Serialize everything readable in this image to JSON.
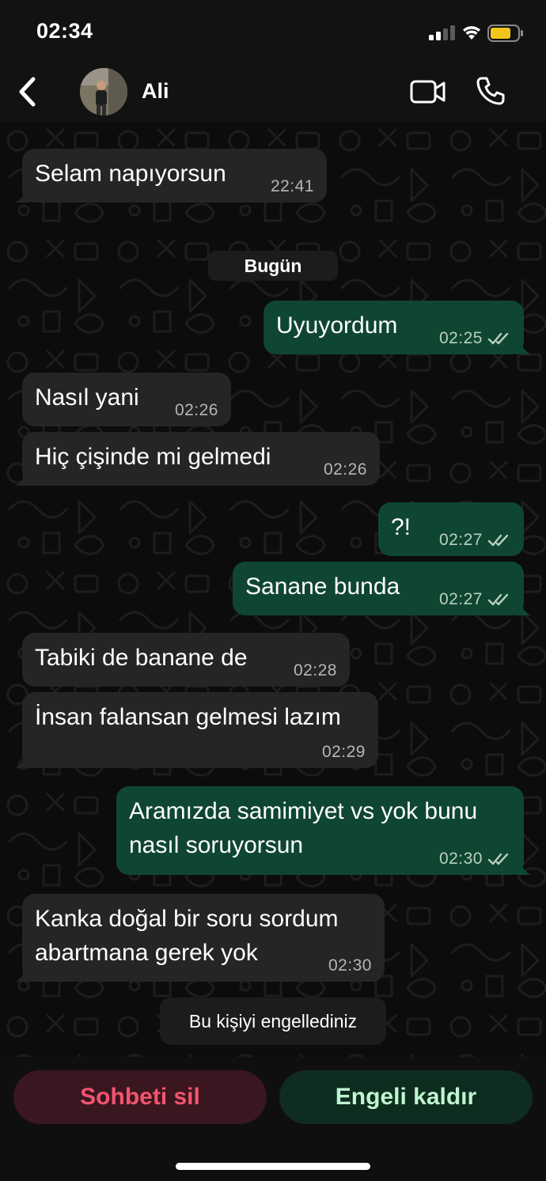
{
  "status_bar": {
    "time": "02:34",
    "battery_color": "#f4c51b"
  },
  "header": {
    "contact_name": "Ali",
    "back_icon": "chevron-left-icon",
    "video_icon": "video-camera-icon",
    "call_icon": "phone-icon"
  },
  "chat": {
    "date_separator": "Bugün",
    "messages": [
      {
        "direction": "in",
        "text": "Selam napıyorsun",
        "time": "22:41"
      },
      {
        "direction": "out",
        "text": "Uyuyordum",
        "time": "02:25",
        "read": true
      },
      {
        "direction": "in",
        "text": "Nasıl yani",
        "time": "02:26"
      },
      {
        "direction": "in",
        "text": "Hiç çişinde mi gelmedi",
        "time": "02:26"
      },
      {
        "direction": "out",
        "text": "?!",
        "time": "02:27",
        "read": true
      },
      {
        "direction": "out",
        "text": "Sanane bunda",
        "time": "02:27",
        "read": true
      },
      {
        "direction": "in",
        "text": "Tabiki de banane de",
        "time": "02:28"
      },
      {
        "direction": "in",
        "text": "İnsan falansan gelmesi lazım",
        "time": "02:29"
      },
      {
        "direction": "out",
        "text": "Aramızda samimiyet vs yok bunu\nnasıl soruyorsun",
        "time": "02:30",
        "read": true
      },
      {
        "direction": "in",
        "text": "Kanka doğal bir soru sordum\nabartmana gerek yok",
        "time": "02:30"
      }
    ],
    "system_notice": "Bu kişiyi engellediniz"
  },
  "actions": {
    "delete_label": "Sohbeti sil",
    "unblock_label": "Engeli kaldır"
  },
  "colors": {
    "incoming_bubble": "#252525",
    "outgoing_bubble": "#0f4632",
    "delete_text": "#f3546e",
    "unblock_text": "#bff5cf"
  }
}
